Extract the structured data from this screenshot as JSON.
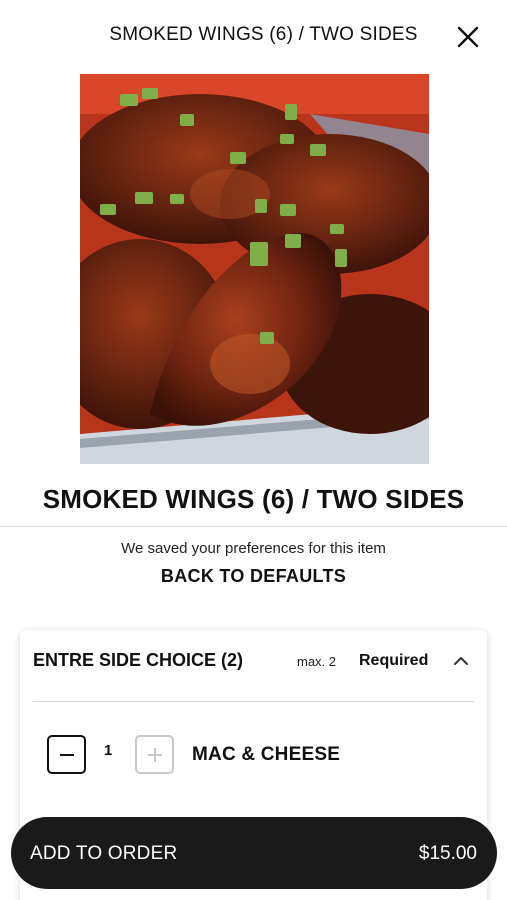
{
  "header": {
    "title": "SMOKED WINGS (6) / TWO SIDES",
    "close_icon": "close-icon"
  },
  "item": {
    "image_icon": "food-photo",
    "title": "SMOKED WINGS (6) / TWO SIDES",
    "preferences_note": "We saved your preferences for this item",
    "back_to_defaults": "BACK TO DEFAULTS"
  },
  "modifier_group": {
    "name": "ENTRE SIDE CHOICE (2)",
    "max": "max. 2",
    "required": "Required",
    "expanded": true,
    "options": [
      {
        "quantity": "1",
        "name": "MAC & CHEESE"
      }
    ]
  },
  "footer": {
    "add_label": "ADD TO ORDER",
    "price": "$15.00"
  },
  "colors": {
    "bar": "#1a1a1a",
    "divider": "#d9d9d9",
    "disabled": "#c8c8c8"
  }
}
